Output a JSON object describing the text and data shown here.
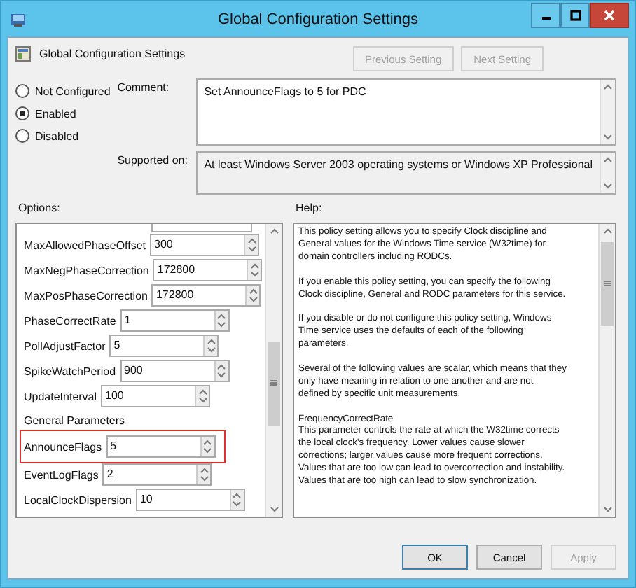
{
  "window": {
    "title": "Global Configuration Settings"
  },
  "header": {
    "title": "Global Configuration Settings",
    "buttons": [
      {
        "label": "Previous Setting",
        "disabled": true
      },
      {
        "label": "Next Setting",
        "disabled": true
      }
    ]
  },
  "state_options": [
    {
      "label": "Not Configured",
      "selected": false
    },
    {
      "label": "Enabled",
      "selected": true
    },
    {
      "label": "Disabled",
      "selected": false
    }
  ],
  "comment": {
    "label": "Comment:",
    "value": "Set AnnounceFlags to 5 for PDC"
  },
  "supported_on": {
    "label": "Supported on:",
    "value": "At least Windows Server 2003 operating systems or Windows XP Professional"
  },
  "options": {
    "label": "Options:",
    "rows": [
      {
        "kind": "spin",
        "label": "MaxAllowedPhaseOffset",
        "value": "300",
        "highlighted": false
      },
      {
        "kind": "spin",
        "label": "MaxNegPhaseCorrection",
        "value": "172800",
        "highlighted": false
      },
      {
        "kind": "spin",
        "label": "MaxPosPhaseCorrection",
        "value": "172800",
        "highlighted": false
      },
      {
        "kind": "spin",
        "label": "PhaseCorrectRate",
        "value": "1",
        "highlighted": false
      },
      {
        "kind": "spin",
        "label": "PollAdjustFactor",
        "value": "5",
        "highlighted": false
      },
      {
        "kind": "spin",
        "label": "SpikeWatchPeriod",
        "value": "900",
        "highlighted": false
      },
      {
        "kind": "spin",
        "label": "UpdateInterval",
        "value": "100",
        "highlighted": false
      },
      {
        "kind": "heading",
        "label": "General Parameters"
      },
      {
        "kind": "spin",
        "label": "AnnounceFlags",
        "value": "5",
        "highlighted": true
      },
      {
        "kind": "spin",
        "label": "EventLogFlags",
        "value": "2",
        "highlighted": false
      },
      {
        "kind": "spin",
        "label": "LocalClockDispersion",
        "value": "10",
        "highlighted": false
      }
    ]
  },
  "help": {
    "label": "Help:",
    "paragraphs": [
      [
        "This policy setting allows you to specify Clock discipline and",
        "General values for the Windows Time service (W32time) for",
        "domain controllers including RODCs."
      ],
      [
        "If you enable this policy setting, you can specify the following",
        "Clock discipline, General and RODC  parameters for this service."
      ],
      [
        "If you disable or do not configure this policy setting, Windows",
        "Time service uses the defaults of each of the following",
        "parameters."
      ],
      [
        "Several of the following values are scalar, which means that they",
        "only have meaning in relation to one another and are not",
        "defined by specific unit measurements."
      ],
      [
        "FrequencyCorrectRate",
        "This parameter controls the rate at which the W32time corrects",
        "the local clock's frequency. Lower values cause slower",
        "corrections; larger values cause more frequent corrections.",
        "Values that are too low can lead to overcorrection and instability.",
        "Values that are too high can lead to slow synchronization."
      ]
    ]
  },
  "buttons": [
    {
      "label": "OK",
      "disabled": false,
      "default": true
    },
    {
      "label": "Cancel",
      "disabled": false,
      "default": false
    },
    {
      "label": "Apply",
      "disabled": true,
      "default": false
    }
  ]
}
